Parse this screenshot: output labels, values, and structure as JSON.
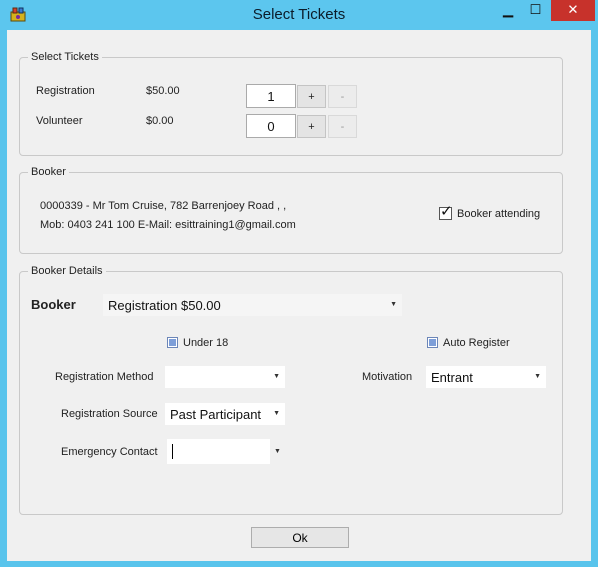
{
  "window": {
    "title": "Select Tickets",
    "icon": "ticket-app-icon",
    "minimize_glyph": "▁",
    "maximize_glyph": "☐",
    "close_glyph": "✕"
  },
  "select_tickets": {
    "legend": "Select Tickets",
    "tickets": [
      {
        "name": "Registration",
        "price": "$50.00",
        "qty": "1",
        "plus": "+",
        "minus": "-"
      },
      {
        "name": "Volunteer",
        "price": "$0.00",
        "qty": "0",
        "plus": "+",
        "minus": "-"
      }
    ]
  },
  "booker": {
    "legend": "Booker",
    "line1": "0000339 - Mr Tom Cruise,  782 Barrenjoey Road , ,",
    "line2": "Mob: 0403 241 100 E-Mail: esittraining1@gmail.com",
    "attending_label": "Booker attending",
    "attending_checked": true,
    "check_glyph": "✓"
  },
  "booker_details": {
    "legend": "Booker Details",
    "booker_label": "Booker",
    "booker_value": "Registration $50.00",
    "under18_label": "Under 18",
    "auto_register_label": "Auto Register",
    "registration_method_label": "Registration Method",
    "registration_method_value": "",
    "motivation_label": "Motivation",
    "motivation_value": "Entrant",
    "registration_source_label": "Registration Source",
    "registration_source_value": "Past Participant",
    "emergency_contact_label": "Emergency Contact",
    "emergency_contact_value": "",
    "dropdown_glyph": "▼"
  },
  "footer": {
    "ok_label": "Ok"
  },
  "colors": {
    "titlebar": "#5cc6ee",
    "close": "#c7322b",
    "dialog_bg": "#f0f0f0"
  }
}
